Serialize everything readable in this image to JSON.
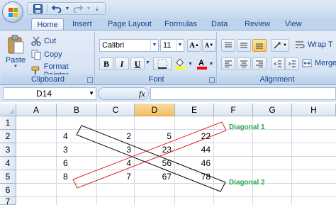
{
  "qat": {
    "save_icon": "save-icon",
    "undo_icon": "undo-icon",
    "redo_icon": "redo-icon",
    "customize_icon": "chevron-down-icon"
  },
  "tabs": [
    "Home",
    "Insert",
    "Page Layout",
    "Formulas",
    "Data",
    "Review",
    "View"
  ],
  "ribbon": {
    "clipboard": {
      "paste": "Paste",
      "cut": "Cut",
      "copy": "Copy",
      "format_painter": "Format Painter",
      "label": "Clipboard"
    },
    "font": {
      "font_name": "Calibri",
      "font_size": "11",
      "bold": "B",
      "italic": "I",
      "underline": "U",
      "label": "Font",
      "highlight_color": "#ffff00",
      "font_color": "#ff0000"
    },
    "alignment": {
      "wrap_text": "Wrap T",
      "merge": "Merge",
      "label": "Alignment"
    }
  },
  "formula_bar": {
    "name_box": "D14",
    "fx": "fx",
    "formula": ""
  },
  "sheet": {
    "columns": [
      "A",
      "B",
      "C",
      "D",
      "E",
      "F",
      "G",
      "H"
    ],
    "selected_column": "D",
    "rows": [
      "1",
      "2",
      "3",
      "4",
      "5",
      "6",
      "7"
    ],
    "values": [
      [
        "4",
        "2",
        "5",
        "22"
      ],
      [
        "3",
        "3",
        "23",
        "44"
      ],
      [
        "6",
        "4",
        "56",
        "46"
      ],
      [
        "8",
        "7",
        "67",
        "78"
      ]
    ],
    "annotations": {
      "diagonal1": "Diagonal 1",
      "diagonal2": "Diagonal 2"
    },
    "colors": {
      "diagonal1_box": "#e02020",
      "diagonal2_box": "#000000",
      "label": "#2fa84f"
    }
  }
}
